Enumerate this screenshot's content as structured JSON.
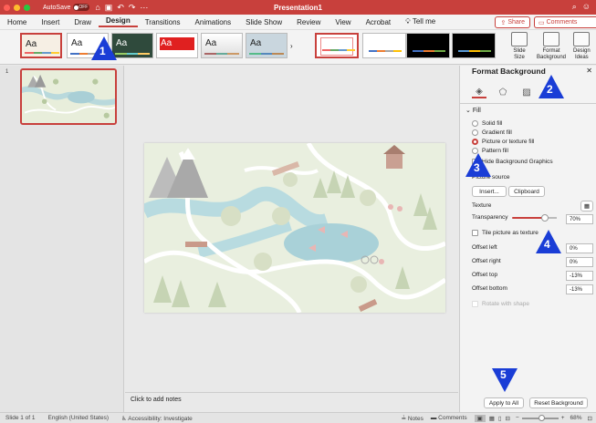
{
  "titlebar": {
    "autosave_label": "AutoSave",
    "autosave_state": "OFF",
    "doc_title": "Presentation1"
  },
  "menu": {
    "items": [
      "Home",
      "Insert",
      "Draw",
      "Design",
      "Transitions",
      "Animations",
      "Slide Show",
      "Review",
      "View",
      "Acrobat"
    ],
    "tell_me": "Tell me",
    "active": "Design",
    "share": "Share",
    "comments": "Comments"
  },
  "ribbon": {
    "theme_label": "Aa",
    "slide_size": "Slide\nSize",
    "format_background": "Format\nBackground",
    "design_ideas": "Design\nIdeas"
  },
  "slide_panel": {
    "slide_number": "1"
  },
  "notes": {
    "placeholder": "Click to add notes"
  },
  "format_panel": {
    "title": "Format Background",
    "section": "Fill",
    "options": [
      "Solid fill",
      "Gradient fill",
      "Picture or texture fill",
      "Pattern fill"
    ],
    "selected_option": "Picture or texture fill",
    "hide_graphics": "Hide Background Graphics",
    "picture_source": "Picture source",
    "insert_btn": "Insert...",
    "clipboard_btn": "Clipboard",
    "texture": "Texture",
    "transparency": "Transparency",
    "transparency_value": "70%",
    "transparency_fraction": 0.7,
    "tile": "Tile picture as texture",
    "offset_left": "Offset left",
    "offset_left_value": "0%",
    "offset_right": "Offset right",
    "offset_right_value": "0%",
    "offset_top": "Offset top",
    "offset_top_value": "-13%",
    "offset_bottom": "Offset bottom",
    "offset_bottom_value": "-13%",
    "rotate": "Rotate with shape",
    "apply_all": "Apply to All",
    "reset": "Reset Background"
  },
  "status": {
    "slide_of": "Slide 1 of 1",
    "language": "English (United States)",
    "accessibility": "Accessibility: Investigate",
    "notes": "Notes",
    "comments": "Comments",
    "zoom": "68%"
  },
  "callouts": [
    "1",
    "2",
    "3",
    "4",
    "5"
  ],
  "colors": {
    "accent": "#c8403c",
    "callout": "#1a3dd6"
  }
}
